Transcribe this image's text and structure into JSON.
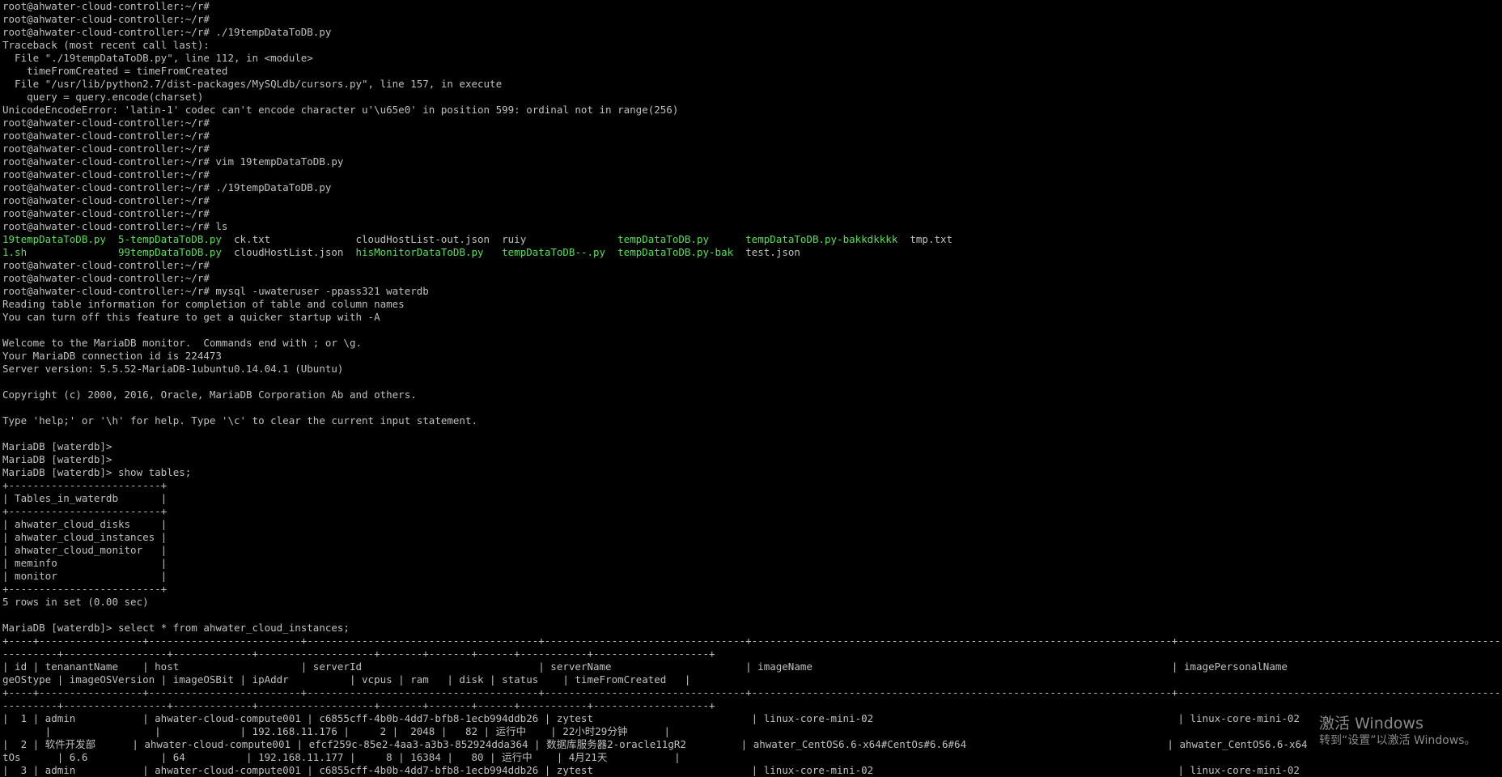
{
  "colors": {
    "background": "#000000",
    "text": "#c0c0c0",
    "executable": "#55e055",
    "watermark": "#8a8a8a"
  },
  "terminal": {
    "lines": [
      [
        {
          "t": "root@ahwater-cloud-controller:~/r#"
        }
      ],
      [
        {
          "t": "root@ahwater-cloud-controller:~/r#"
        }
      ],
      [
        {
          "t": "root@ahwater-cloud-controller:~/r# ./19tempDataToDB.py"
        }
      ],
      [
        {
          "t": "Traceback (most recent call last):"
        }
      ],
      [
        {
          "t": "  File \"./19tempDataToDB.py\", line 112, in <module>"
        }
      ],
      [
        {
          "t": "    timeFromCreated = timeFromCreated"
        }
      ],
      [
        {
          "t": "  File \"/usr/lib/python2.7/dist-packages/MySQLdb/cursors.py\", line 157, in execute"
        }
      ],
      [
        {
          "t": "    query = query.encode(charset)"
        }
      ],
      [
        {
          "t": "UnicodeEncodeError: 'latin-1' codec can't encode character u'\\u65e0' in position 599: ordinal not in range(256)"
        }
      ],
      [
        {
          "t": "root@ahwater-cloud-controller:~/r#"
        }
      ],
      [
        {
          "t": "root@ahwater-cloud-controller:~/r#"
        }
      ],
      [
        {
          "t": "root@ahwater-cloud-controller:~/r#"
        }
      ],
      [
        {
          "t": "root@ahwater-cloud-controller:~/r# vim 19tempDataToDB.py"
        }
      ],
      [
        {
          "t": "root@ahwater-cloud-controller:~/r#"
        }
      ],
      [
        {
          "t": "root@ahwater-cloud-controller:~/r# ./19tempDataToDB.py"
        }
      ],
      [
        {
          "t": "root@ahwater-cloud-controller:~/r#"
        }
      ],
      [
        {
          "t": "root@ahwater-cloud-controller:~/r#"
        }
      ],
      [
        {
          "t": "root@ahwater-cloud-controller:~/r# ls"
        }
      ],
      [
        {
          "t": "19tempDataToDB.py",
          "c": "green"
        },
        {
          "t": "  "
        },
        {
          "t": "5-tempDataToDB.py",
          "c": "green"
        },
        {
          "t": "  ck.txt              cloudHostList-out.json  ruiy               "
        },
        {
          "t": "tempDataToDB.py",
          "c": "green"
        },
        {
          "t": "      "
        },
        {
          "t": "tempDataToDB.py-bakkdkkkk",
          "c": "green"
        },
        {
          "t": "  tmp.txt"
        }
      ],
      [
        {
          "t": "1.sh",
          "c": "green"
        },
        {
          "t": "               "
        },
        {
          "t": "99tempDataToDB.py",
          "c": "green"
        },
        {
          "t": "  cloudHostList.json  "
        },
        {
          "t": "hisMonitorDataToDB.py",
          "c": "green"
        },
        {
          "t": "   "
        },
        {
          "t": "tempDataToDB--.py",
          "c": "green"
        },
        {
          "t": "  "
        },
        {
          "t": "tempDataToDB.py-bak",
          "c": "green"
        },
        {
          "t": "  test.json"
        }
      ],
      [
        {
          "t": "root@ahwater-cloud-controller:~/r#"
        }
      ],
      [
        {
          "t": "root@ahwater-cloud-controller:~/r#"
        }
      ],
      [
        {
          "t": "root@ahwater-cloud-controller:~/r# mysql -uwateruser -ppass321 waterdb"
        }
      ],
      [
        {
          "t": "Reading table information for completion of table and column names"
        }
      ],
      [
        {
          "t": "You can turn off this feature to get a quicker startup with -A"
        }
      ],
      [
        {
          "t": ""
        }
      ],
      [
        {
          "t": "Welcome to the MariaDB monitor.  Commands end with ; or \\g."
        }
      ],
      [
        {
          "t": "Your MariaDB connection id is 224473"
        }
      ],
      [
        {
          "t": "Server version: 5.5.52-MariaDB-1ubuntu0.14.04.1 (Ubuntu)"
        }
      ],
      [
        {
          "t": ""
        }
      ],
      [
        {
          "t": "Copyright (c) 2000, 2016, Oracle, MariaDB Corporation Ab and others."
        }
      ],
      [
        {
          "t": ""
        }
      ],
      [
        {
          "t": "Type 'help;' or '\\h' for help. Type '\\c' to clear the current input statement."
        }
      ],
      [
        {
          "t": ""
        }
      ],
      [
        {
          "t": "MariaDB [waterdb]>"
        }
      ],
      [
        {
          "t": "MariaDB [waterdb]>"
        }
      ],
      [
        {
          "t": "MariaDB [waterdb]> show tables;"
        }
      ],
      [
        {
          "t": "+-------------------------+"
        }
      ],
      [
        {
          "t": "| Tables_in_waterdb       |"
        }
      ],
      [
        {
          "t": "+-------------------------+"
        }
      ],
      [
        {
          "t": "| ahwater_cloud_disks     |"
        }
      ],
      [
        {
          "t": "| ahwater_cloud_instances |"
        }
      ],
      [
        {
          "t": "| ahwater_cloud_monitor   |"
        }
      ],
      [
        {
          "t": "| meminfo                 |"
        }
      ],
      [
        {
          "t": "| monitor                 |"
        }
      ],
      [
        {
          "t": "+-------------------------+"
        }
      ],
      [
        {
          "t": "5 rows in set (0.00 sec)"
        }
      ],
      [
        {
          "t": ""
        }
      ],
      [
        {
          "t": "MariaDB [waterdb]> select * from ahwater_cloud_instances;"
        }
      ],
      [
        {
          "t": "+----+-----------------+-------------------------+--------------------------------------+---------------------------------+---------------------------------------------------------------------+-----------------------------------------------------------------------"
        }
      ],
      [
        {
          "t": "---------+-----------------+-------------+-------------------+-------+-------+------+-----------+-------------------+"
        }
      ],
      [
        {
          "t": "| id | tenanantName    | host                    | serverId                             | serverName                      | imageName                                                           | imagePersonalName"
        }
      ],
      [
        {
          "t": "geOStype | imageOSVersion | imageOSBit | ipAddr          | vcpus | ram   | disk | status    | timeFromCreated   |"
        }
      ],
      [
        {
          "t": "+----+-----------------+-------------------------+--------------------------------------+---------------------------------+---------------------------------------------------------------------+-----------------------------------------------------------------------"
        }
      ],
      [
        {
          "t": "---------+-----------------+-------------+-------------------+-------+-------+------+-----------+-------------------+"
        }
      ],
      [
        {
          "t": "|  1 | admin           | ahwater-cloud-compute001 | c6855cff-4b0b-4dd7-bfb8-1ecb994ddb26 | zytest                          | linux-core-mini-02                                                  | linux-core-mini-02"
        }
      ],
      [
        {
          "t": "       |                 |             | 192.168.11.176 |     2 |  2048 |   82 | 运行中    | 22小时29分钟      |"
        }
      ],
      [
        {
          "t": "|  2 | 软件开发部      | ahwater-cloud-compute001 | efcf259c-85e2-4aa3-a3b3-852924dda364 | 数据库服务器2-oracle11gR2         | ahwater_CentOS6.6-x64#CentOs#6.6#64                                 | ahwater_CentOS6.6-x64"
        }
      ],
      [
        {
          "t": "tOs      | 6.6            | 64          | 192.168.11.177 |     8 | 16384 |   80 | 运行中    | 4月21天           |"
        }
      ],
      [
        {
          "t": "|  3 | admin           | ahwater-cloud-compute001 | c6855cff-4b0b-4dd7-bfb8-1ecb994ddb26 | zytest                          | linux-core-mini-02                                                  | linux-core-mini-02"
        }
      ]
    ]
  },
  "watermark": {
    "title": "激活 Windows",
    "subtitle": "转到“设置”以激活 Windows。"
  }
}
